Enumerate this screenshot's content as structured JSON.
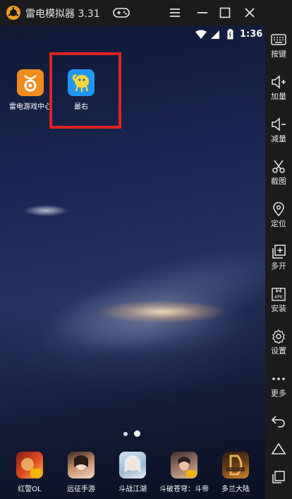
{
  "window": {
    "title": "雷电模拟器 3.31",
    "accent": "#f39c1e"
  },
  "status_bar": {
    "time": "1:36"
  },
  "home": {
    "apps": [
      {
        "label": "雷电游戏中心",
        "icon": "ldplayer-store-icon",
        "color": "#f08c1e"
      },
      {
        "label": "最右",
        "icon": "zuiyou-icon",
        "color": "#2196f3"
      }
    ],
    "highlight_color": "#e0231f",
    "pages": 2,
    "current_page": 2
  },
  "dock": {
    "apps": [
      {
        "label": "红警OL",
        "icon": "red-alert-game-icon"
      },
      {
        "label": "远征手游",
        "icon": "expedition-game-icon"
      },
      {
        "label": "斗战江湖",
        "icon": "doujianghu-game-icon"
      },
      {
        "label": "斗破苍穹：斗帝",
        "icon": "doupo-game-icon"
      },
      {
        "label": "多兰大陆",
        "icon": "dolan-game-icon"
      }
    ]
  },
  "sidebar": {
    "items": [
      {
        "label": "按键",
        "icon": "keyboard-icon"
      },
      {
        "label": "加量",
        "icon": "volume-up-icon"
      },
      {
        "label": "减量",
        "icon": "volume-down-icon"
      },
      {
        "label": "截图",
        "icon": "scissors-icon"
      },
      {
        "label": "定位",
        "icon": "location-pin-icon"
      },
      {
        "label": "多开",
        "icon": "multi-instance-icon"
      },
      {
        "label": "安装",
        "icon": "apk-install-icon"
      },
      {
        "label": "设置",
        "icon": "gear-icon"
      },
      {
        "label": "更多",
        "icon": "more-dots-icon"
      }
    ],
    "nav": [
      "back-icon",
      "home-icon",
      "recents-icon"
    ]
  }
}
